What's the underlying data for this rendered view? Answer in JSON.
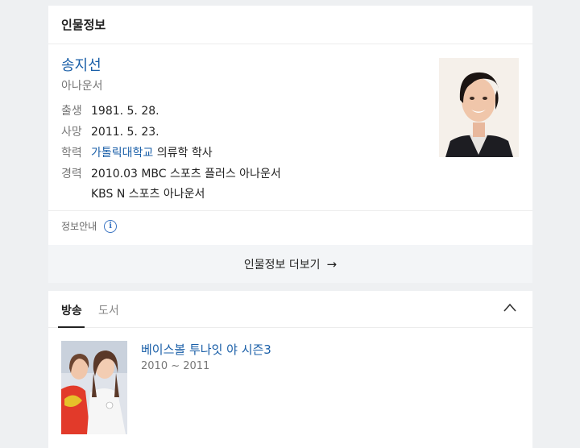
{
  "profile_card": {
    "header": "인물정보",
    "name": "송지선",
    "occupation": "아나운서",
    "rows": {
      "birth": {
        "label": "출생",
        "value": "1981. 5. 28."
      },
      "death": {
        "label": "사망",
        "value": "2011. 5. 23."
      },
      "education": {
        "label": "학력",
        "school": "가톨릭대학교",
        "detail": " 의류학 학사"
      },
      "career": {
        "label": "경력",
        "line1": "2010.03 MBC 스포츠 플러스 아나운서",
        "line2": "KBS N 스포츠 아나운서"
      }
    },
    "notice_label": "정보안내",
    "notice_icon": "info-circle-icon",
    "more_label": "인물정보 더보기",
    "more_icon": "arrow-right-icon",
    "accent_color": "#1a5fa8"
  },
  "works_card": {
    "tabs": [
      "방송",
      "도서"
    ],
    "active_tab": "방송",
    "collapse_icon": "chevron-up-icon",
    "items": [
      {
        "title": "베이스볼 투나잇 야 시즌3",
        "period": "2010 ~ 2011"
      }
    ]
  }
}
